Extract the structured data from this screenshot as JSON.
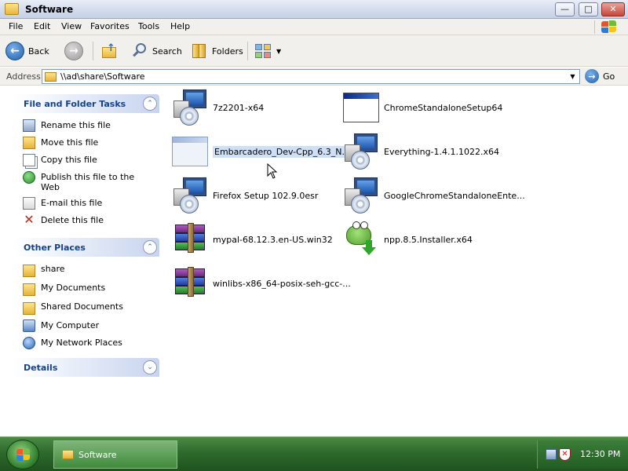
{
  "window": {
    "title": "Software"
  },
  "menu": [
    "File",
    "Edit",
    "View",
    "Favorites",
    "Tools",
    "Help"
  ],
  "toolbar": {
    "back": "Back",
    "search": "Search",
    "folders": "Folders"
  },
  "address": {
    "label": "Address",
    "value": "\\\\ad\\share\\Software",
    "go": "Go"
  },
  "file_tasks": {
    "title": "File and Folder Tasks",
    "items": [
      "Rename this file",
      "Move this file",
      "Copy this file",
      "Publish this file to the Web",
      "E-mail this file",
      "Delete this file"
    ]
  },
  "other_places": {
    "title": "Other Places",
    "items": [
      "share",
      "My Documents",
      "Shared Documents",
      "My Computer",
      "My Network Places"
    ]
  },
  "details": {
    "title": "Details"
  },
  "files": [
    {
      "name": "7z2201-x64",
      "icon": "installer-icon"
    },
    {
      "name": "ChromeStandaloneSetup64",
      "icon": "window-app-icon"
    },
    {
      "name": "Embarcadero_Dev-Cpp_6.3_N...",
      "icon": "window-app-icon",
      "selected": true
    },
    {
      "name": "Everything-1.4.1.1022.x64",
      "icon": "installer-icon"
    },
    {
      "name": "Firefox Setup 102.9.0esr",
      "icon": "installer-icon"
    },
    {
      "name": "GoogleChromeStandaloneEnte...",
      "icon": "installer-icon"
    },
    {
      "name": "mypal-68.12.3.en-US.win32",
      "icon": "archive-icon"
    },
    {
      "name": "npp.8.5.Installer.x64",
      "icon": "notepadpp-icon"
    },
    {
      "name": "winlibs-x86_64-posix-seh-gcc-...",
      "icon": "archive-icon"
    }
  ],
  "taskbar": {
    "window_button": "Software",
    "clock": "12:30 PM"
  }
}
